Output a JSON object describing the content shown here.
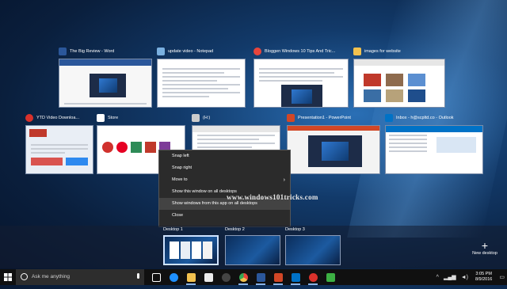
{
  "windows": [
    {
      "title": "The Big Review - Word",
      "icon": "word-icon",
      "color": "#2b579a"
    },
    {
      "title": "update video - Notepad",
      "icon": "notepad-icon",
      "color": "#7ab0e0"
    },
    {
      "title": "Bloggen Windows 10 Tips And Tric...",
      "icon": "chrome-icon",
      "color": "#e8453c"
    },
    {
      "title": "images for website",
      "icon": "folder-icon",
      "color": "#f2c14e"
    },
    {
      "title": "YTD Video Downloa...",
      "icon": "ytd-icon",
      "color": "#d9312b"
    },
    {
      "title": "Store",
      "icon": "store-icon",
      "color": "#ffffff"
    },
    {
      "title": "(H:)",
      "icon": "drive-icon",
      "color": "#cccccc"
    },
    {
      "title": "Presentation1 - PowerPoint",
      "icon": "powerpoint-icon",
      "color": "#d24726"
    },
    {
      "title": "Inbox - h@scpltd.co - Outlook",
      "icon": "outlook-icon",
      "color": "#0072c6"
    }
  ],
  "context_menu": {
    "items": [
      "Snap left",
      "Snap right",
      "Move to",
      "Show this window on all desktops",
      "Show windows from this app on all desktops",
      "Close"
    ],
    "submenu_arrow": "›",
    "highlighted_index": 4
  },
  "watermark": "www.windows101tricks.com",
  "desktops": [
    {
      "label": "Desktop 1"
    },
    {
      "label": "Desktop 2"
    },
    {
      "label": "Desktop 3"
    }
  ],
  "new_desktop": {
    "plus": "+",
    "label": "New desktop"
  },
  "taskbar": {
    "search_placeholder": "Ask me anything",
    "icons": [
      "task-view-icon",
      "edge-icon",
      "explorer-icon",
      "store-icon",
      "media-icon",
      "chrome-icon",
      "word-icon",
      "powerpoint-icon",
      "outlook-icon",
      "ytd-icon",
      "camtasia-icon"
    ]
  },
  "tray": {
    "chevron": "^",
    "time": "3:05 PM",
    "date": "8/9/2016"
  }
}
